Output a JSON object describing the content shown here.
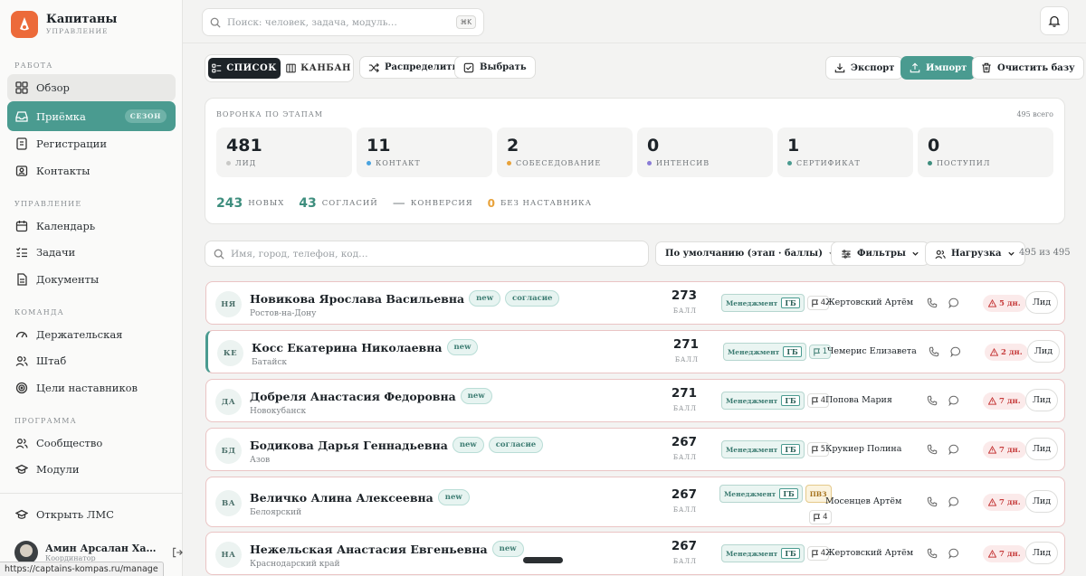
{
  "brand": {
    "title": "Капитаны",
    "subtitle": "УПРАВЛЕНИЕ"
  },
  "sidebar": {
    "sections": {
      "work": "РАБОТА",
      "management": "УПРАВЛЕНИЕ",
      "team": "КОМАНДА",
      "program": "ПРОГРАММА"
    },
    "items": [
      {
        "label": "Обзор",
        "icon": "grid-icon"
      },
      {
        "label": "Приёмка",
        "icon": "inbox-icon",
        "badge": "СЕЗОН"
      },
      {
        "label": "Регистрации",
        "icon": "list-icon"
      },
      {
        "label": "Контакты",
        "icon": "contact-icon"
      },
      {
        "label": "Календарь",
        "icon": "calendar-icon"
      },
      {
        "label": "Задачи",
        "icon": "tasks-icon"
      },
      {
        "label": "Документы",
        "icon": "document-icon"
      },
      {
        "label": "Держательская",
        "icon": "gauge-icon"
      },
      {
        "label": "Штаб",
        "icon": "users-icon"
      },
      {
        "label": "Цели наставников",
        "icon": "target-icon"
      },
      {
        "label": "Сообщество",
        "icon": "community-icon"
      },
      {
        "label": "Модули",
        "icon": "graduation-icon"
      }
    ],
    "open_lms": "Открыть ЛМС",
    "user": {
      "name": "Амин Арсалан Ха…",
      "role": "Координатор"
    }
  },
  "status_url": "https://captains-kompas.ru/manage",
  "top": {
    "search_placeholder": "Поиск: человек, задача, модуль…",
    "shortcut": "⌘K"
  },
  "toolbar": {
    "list": "СПИСОК",
    "kanban": "КАНБАН",
    "distribute": "Распределить",
    "select": "Выбрать",
    "export": "Экспорт",
    "import": "Импорт",
    "clear": "Очистить базу"
  },
  "funnel": {
    "title": "ВОРОНКА ПО ЭТАПАМ",
    "total": "495 всего",
    "stages": [
      {
        "count": "481",
        "label": "ЛИД",
        "color": "#c9c9c7"
      },
      {
        "count": "11",
        "label": "КОНТАКТ",
        "color": "#4aa3df"
      },
      {
        "count": "2",
        "label": "СОБЕСЕДОВАНИЕ",
        "color": "#e8a23a"
      },
      {
        "count": "0",
        "label": "ИНТЕНСИВ",
        "color": "#8a7cd6"
      },
      {
        "count": "1",
        "label": "СЕРТИФИКАТ",
        "color": "#4a9b90"
      },
      {
        "count": "0",
        "label": "ПОСТУПИЛ",
        "color": "#3e8e7e"
      }
    ],
    "stats": {
      "new_count": "243",
      "new_label": "НОВЫХ",
      "consent_count": "43",
      "consent_label": "СОГЛАСИЙ",
      "conv_value": "—",
      "conv_label": "КОНВЕРСИЯ",
      "nomentor_count": "0",
      "nomentor_label": "БЕЗ НАСТАВНИКА"
    }
  },
  "filters": {
    "search_placeholder": "Имя, город, телефон, код…",
    "sort": "По умолчанию (этап · баллы)",
    "filters": "Фильтры",
    "load": "Нагрузка",
    "count": "495 из 495"
  },
  "rows": [
    {
      "initials": "НЯ",
      "name": "Новикова Ярослава Васильевна",
      "tags": [
        "new",
        "согласие"
      ],
      "city": "Ростов-на-Дону",
      "score": "273",
      "score_label": "БАЛЛ",
      "chip": "Менеджмент",
      "gb": "ГБ",
      "pvz": "",
      "comments": "4",
      "comments_hl": false,
      "mentor": "Жертовский Артём",
      "days": "5 дн.",
      "stage": "Лид",
      "highlight": false
    },
    {
      "initials": "КЕ",
      "name": "Косс Екатерина Николаевна",
      "tags": [
        "new"
      ],
      "city": "Батайск",
      "score": "271",
      "score_label": "БАЛЛ",
      "chip": "Менеджмент",
      "gb": "ГБ",
      "pvz": "",
      "comments": "1",
      "comments_hl": true,
      "mentor": "Чемерис Елизавета",
      "days": "2 дн.",
      "stage": "Лид",
      "highlight": true
    },
    {
      "initials": "ДА",
      "name": "Добреля Анастасия Федоровна",
      "tags": [
        "new"
      ],
      "city": "Новокубанск",
      "score": "271",
      "score_label": "БАЛЛ",
      "chip": "Менеджмент",
      "gb": "ГБ",
      "pvz": "",
      "comments": "4",
      "comments_hl": false,
      "mentor": "Попова Мария",
      "days": "7 дн.",
      "stage": "Лид",
      "highlight": false
    },
    {
      "initials": "БД",
      "name": "Бодикова Дарья Геннадьевна",
      "tags": [
        "new",
        "согласие"
      ],
      "city": "Азов",
      "score": "267",
      "score_label": "БАЛЛ",
      "chip": "Менеджмент",
      "gb": "ГБ",
      "pvz": "",
      "comments": "5",
      "comments_hl": false,
      "mentor": "Крукиер Полина",
      "days": "7 дн.",
      "stage": "Лид",
      "highlight": false
    },
    {
      "initials": "ВА",
      "name": "Величко Алина Алексеевна",
      "tags": [
        "new"
      ],
      "city": "Белоярский",
      "score": "267",
      "score_label": "БАЛЛ",
      "chip": "Менеджмент",
      "gb": "ГБ",
      "pvz": "ПВЗ",
      "comments": "4",
      "comments_hl": false,
      "mentor": "Мосенцев Артём",
      "days": "7 дн.",
      "stage": "Лид",
      "highlight": false
    },
    {
      "initials": "НА",
      "name": "Нежельская Анастасия Евгеньевна",
      "tags": [
        "new"
      ],
      "city": "Краснодарский край",
      "score": "267",
      "score_label": "БАЛЛ",
      "chip": "Менеджмент",
      "gb": "ГБ",
      "pvz": "",
      "comments": "4",
      "comments_hl": false,
      "mentor": "Жертовский Артём",
      "days": "7 дн.",
      "stage": "Лид",
      "highlight": false
    }
  ]
}
